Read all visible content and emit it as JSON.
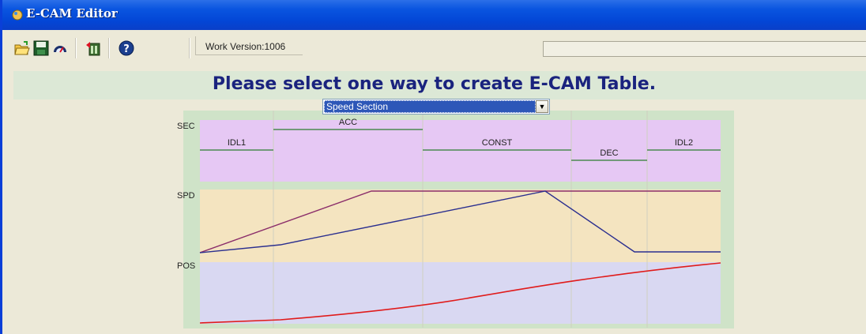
{
  "window": {
    "title": "E-CAM Editor"
  },
  "toolbar": {
    "buttons": [
      "open-icon",
      "save-icon",
      "speed-meter-icon",
      "export-icon",
      "help-icon"
    ],
    "work_version": "Work Version:1006"
  },
  "main": {
    "headline": "Please select one way to create E-CAM Table.",
    "method_select": {
      "selected": "Speed Section"
    }
  },
  "chart_data": {
    "type": "line",
    "row_labels": [
      "SEC",
      "SPD",
      "POS"
    ],
    "sections": [
      {
        "name": "IDL1",
        "level": "mid"
      },
      {
        "name": "ACC",
        "level": "high"
      },
      {
        "name": "CONST",
        "level": "mid"
      },
      {
        "name": "DEC",
        "level": "low"
      },
      {
        "name": "IDL2",
        "level": "mid"
      }
    ],
    "speed_series": [
      {
        "name": "",
        "color": "#8b2e6a"
      },
      {
        "name": "",
        "color": "#2b2f8f"
      }
    ],
    "position_series": {
      "name": "",
      "color": "#e01b1b"
    },
    "colors": {
      "sec_band": "#e6c8f4",
      "spd_band": "#f4e4c0",
      "pos_band": "#d9d8f2",
      "frame": "#cfe3c8",
      "grid": "#cfcfc0"
    }
  }
}
